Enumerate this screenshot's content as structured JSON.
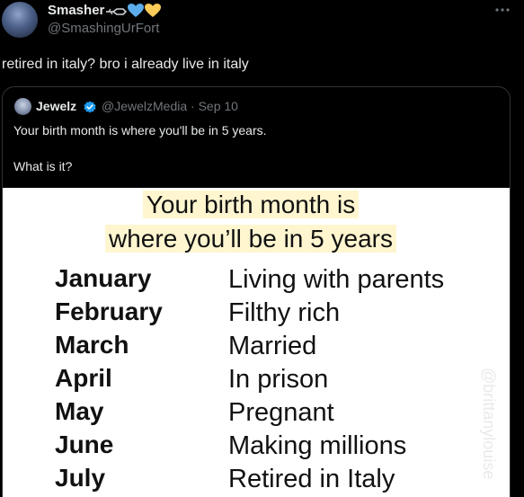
{
  "tweet": {
    "display_name": "Smasher",
    "name_emojis": [
      "rose-emoji",
      "blue-heart-emoji",
      "yellow-heart-emoji"
    ],
    "handle": "@SmashingUrFort",
    "text": "retired in italy? bro i already live in italy",
    "more_icon": "more-horizontal-icon"
  },
  "quote": {
    "display_name": "Jewelz",
    "verified_icon": "verified-badge-icon",
    "handle_and_date": "@JewelzMedia · Sep 10",
    "text_line1": "Your birth month is where you'll be in 5 years.",
    "text_line2": "What is it?"
  },
  "meme": {
    "title_line1": "Your birth month is",
    "title_line2": "where you’ll be in 5 years",
    "rows": [
      {
        "month": "January",
        "fate": "Living with parents"
      },
      {
        "month": "February",
        "fate": "Filthy rich"
      },
      {
        "month": "March",
        "fate": "Married"
      },
      {
        "month": "April",
        "fate": "In prison"
      },
      {
        "month": "May",
        "fate": "Pregnant"
      },
      {
        "month": "June",
        "fate": "Making millions"
      },
      {
        "month": "July",
        "fate": "Retired in Italy"
      }
    ],
    "watermark": "@brittanylouise"
  },
  "colors": {
    "background": "#000000",
    "text_primary": "#e7e9ea",
    "text_secondary": "#71767b",
    "border": "#2f3336",
    "verified_blue": "#1d9bf0"
  }
}
